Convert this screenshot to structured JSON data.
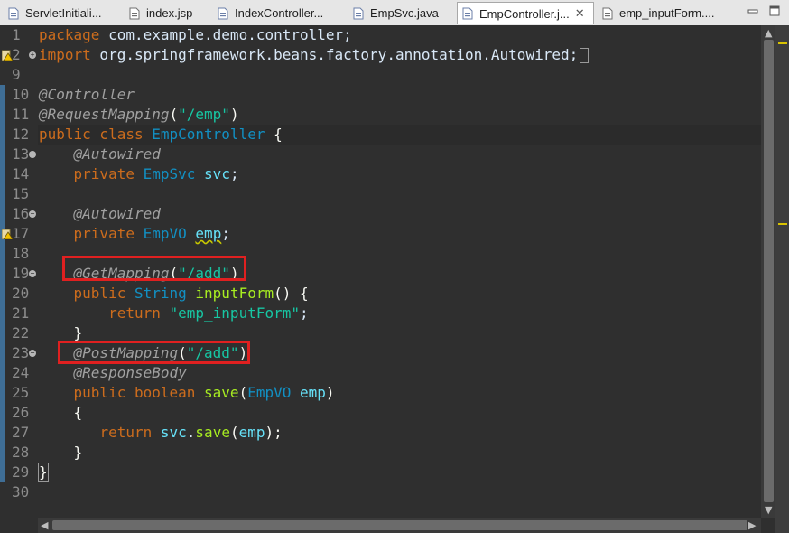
{
  "tabs": [
    {
      "label": "ServletInitiali...",
      "icon": "java-file-icon"
    },
    {
      "label": "index.jsp",
      "icon": "jsp-file-icon"
    },
    {
      "label": "IndexController...",
      "icon": "java-file-icon"
    },
    {
      "label": "EmpSvc.java",
      "icon": "java-file-icon"
    },
    {
      "label": "EmpController.j...",
      "icon": "java-file-icon",
      "active": true,
      "close": "✕"
    },
    {
      "label": "emp_inputForm....",
      "icon": "jsp-file-icon"
    }
  ],
  "line_numbers": [
    "1",
    "2",
    "9",
    "10",
    "11",
    "12",
    "13",
    "14",
    "15",
    "16",
    "17",
    "18",
    "19",
    "20",
    "21",
    "22",
    "23",
    "24",
    "25",
    "26",
    "27",
    "28",
    "29",
    "30"
  ],
  "code": {
    "l1_kw": "package",
    "l1_rest": " com.example.demo.controller;",
    "l2_kw": "import",
    "l2_rest": " org.springframework.beans.factory.annotation.Autowired;",
    "l10": "@Controller",
    "l11_ann": "@RequestMapping",
    "l11_open": "(",
    "l11_str": "\"/emp\"",
    "l11_close": ")",
    "l12_kw": "public class",
    "l12_type": "EmpController",
    "l12_brace": "{",
    "l13": "@Autowired",
    "l14_kw": "private",
    "l14_type": "EmpSvc",
    "l14_field": "svc",
    "l14_semi": ";",
    "l16": "@Autowired",
    "l17_kw": "private",
    "l17_type": "EmpVO",
    "l17_field": "emp",
    "l17_semi": ";",
    "l19_ann": "@GetMapping",
    "l19_open": "(",
    "l19_str": "\"/add\"",
    "l19_close": ")",
    "l20_kw": "public",
    "l20_type": "String",
    "l20_meth": "inputForm",
    "l20_rest": "() {",
    "l21_kw": "return",
    "l21_str": "\"emp_inputForm\"",
    "l21_semi": ";",
    "l22": "}",
    "l23_ann": "@PostMapping",
    "l23_open": "(",
    "l23_str": "\"/add\"",
    "l23_close": ")",
    "l24": "@ResponseBody",
    "l25_kw": "public boolean",
    "l25_meth": "save",
    "l25_open": "(",
    "l25_type": "EmpVO",
    "l25_param": "emp",
    "l25_close": ")",
    "l26": "{",
    "l27_kw": "return",
    "l27_field": "svc",
    "l27_dot": ".",
    "l27_meth": "save",
    "l27_open": "(",
    "l27_param": "emp",
    "l27_close": ");",
    "l28": "}",
    "l29": "}"
  },
  "colors": {
    "keyword": "#cc6c1d",
    "annotation": "#a0a0a0",
    "string": "#17c6a3",
    "type": "#1290c3",
    "field": "#66e1f8",
    "method": "#a7ec21",
    "highlight_box": "#e02020"
  }
}
